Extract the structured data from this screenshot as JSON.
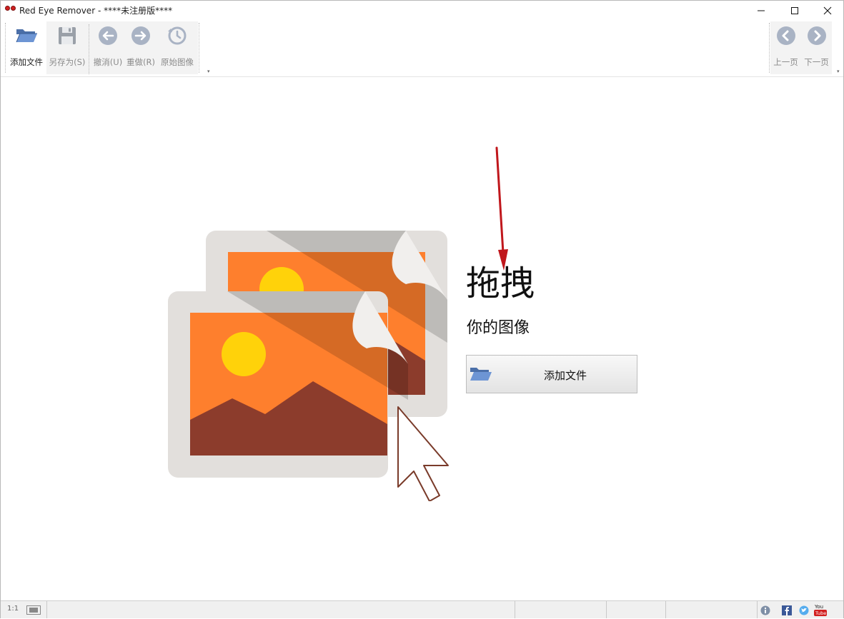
{
  "window": {
    "title": "Red Eye Remover - ****未注册版****",
    "controls": {
      "minimize": "minimize",
      "maximize": "maximize",
      "close": "close"
    }
  },
  "toolbar": {
    "add_file": "添加文件",
    "save_as": "另存为(S)",
    "undo": "撤消(U)",
    "redo": "重做(R)",
    "original": "原始图像",
    "prev_page": "上一页",
    "next_page": "下一页",
    "icons": {
      "add_file": "open-folder-icon",
      "save_as": "floppy-disk-icon",
      "undo": "arrow-left-circle-icon",
      "redo": "arrow-right-circle-icon",
      "original": "clock-history-icon",
      "prev_page": "chevron-left-circle-icon",
      "next_page": "chevron-right-circle-icon"
    }
  },
  "main": {
    "headline": "拖拽",
    "subline": "你的图像",
    "add_button_label": "添加文件",
    "illustration": "stacked-photos-with-cursor-illustration"
  },
  "statusbar": {
    "zoom": "1:1",
    "icons": [
      "info-icon",
      "facebook-icon",
      "twitter-icon",
      "youtube-icon"
    ]
  },
  "colors": {
    "accent_orange": "#fe7f2d",
    "mountain": "#8c3c2c",
    "sun": "#ffd20a",
    "frame_gray": "#e4e0dc",
    "arrow_red": "#c0171c"
  }
}
